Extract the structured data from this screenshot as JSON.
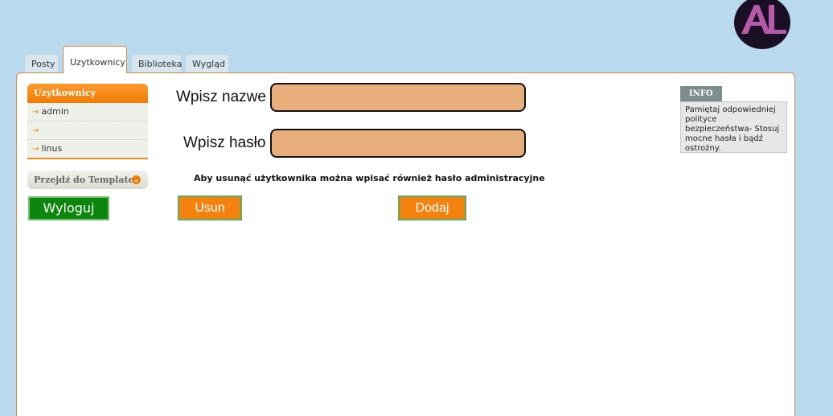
{
  "logo": {
    "text": "AL",
    "colors": {
      "outer": "#1a0f24",
      "letters": "#b55aa8"
    }
  },
  "tabs": [
    {
      "label": "Posty"
    },
    {
      "label": "Uzytkownicy",
      "active": true
    },
    {
      "label": "Biblioteka"
    },
    {
      "label": "Wygląd"
    }
  ],
  "sidebar": {
    "header": "Uzytkownicy",
    "items": [
      {
        "arrow": "→",
        "label": "admin"
      },
      {
        "arrow": "→",
        "label": ""
      },
      {
        "arrow": "→",
        "label": "linus"
      }
    ],
    "template_label": "Przejdź do Template",
    "template_chevron": "⌄",
    "logout_label": "Wyloguj"
  },
  "form": {
    "name_label": "Wpisz nazwe",
    "name_value": "",
    "password_label": "Wpisz hasło",
    "password_value": "",
    "note": "Aby usunąć użytkownika można wpisać również hasło administracyjne",
    "delete_label": "Usun",
    "add_label": "Dodaj"
  },
  "info": {
    "title": "INFO",
    "text": "Pamiętaj odpowiedniej polityce bezpieczeństwa- Stosuj mocne hasła i bądź ostrożny."
  },
  "colors": {
    "background": "#b9d9ee",
    "accent": "#f07d05",
    "field": "#e8ae7c",
    "logout": "#0d860d"
  }
}
